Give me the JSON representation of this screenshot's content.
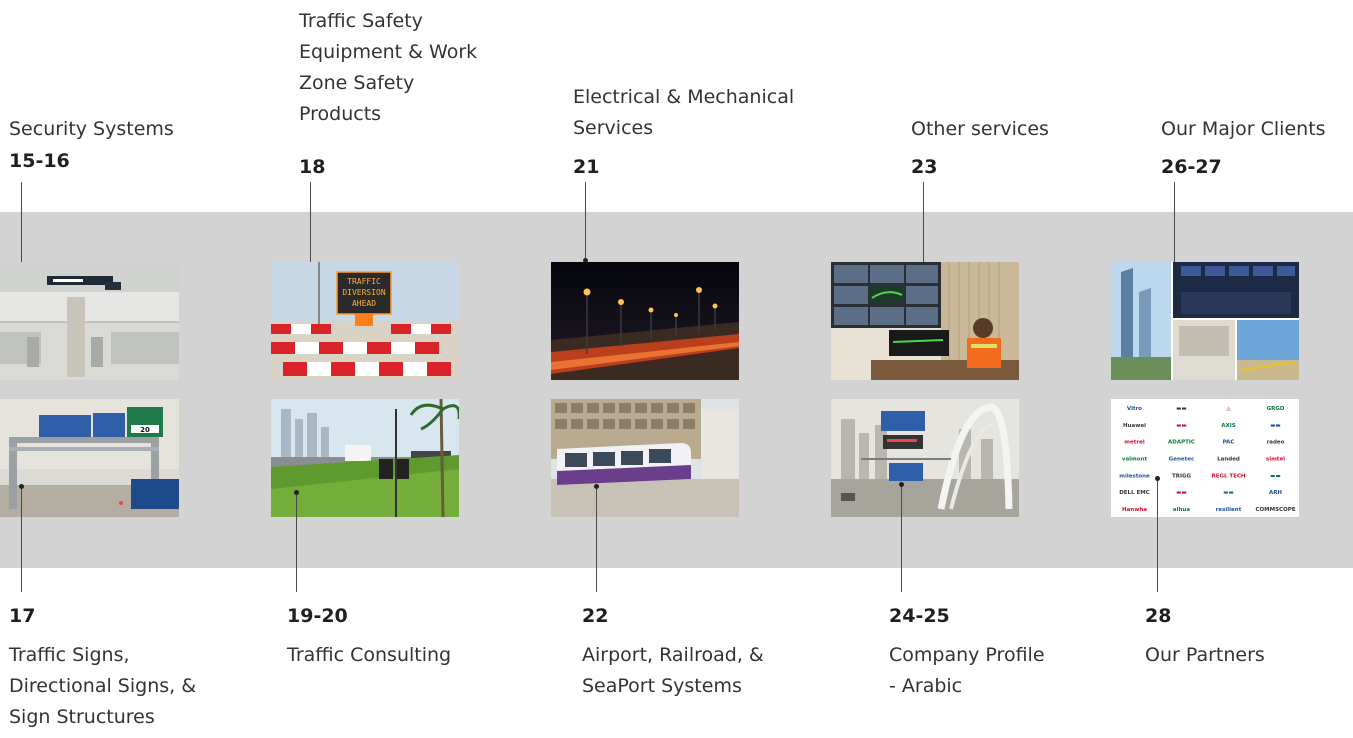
{
  "top_items": [
    {
      "id": "security",
      "lines": [
        "Security Systems"
      ],
      "pages": "15-16"
    },
    {
      "id": "traffic-safety",
      "lines": [
        "Traffic Safety",
        "Equipment & Work",
        "Zone Safety",
        "Products"
      ],
      "pages": "18"
    },
    {
      "id": "electrical",
      "lines": [
        "Electrical & Mechanical",
        "Services"
      ],
      "pages": "21"
    },
    {
      "id": "other",
      "lines": [
        "Other services"
      ],
      "pages": "23"
    },
    {
      "id": "clients",
      "lines": [
        "Our Major Clients"
      ],
      "pages": "26-27"
    }
  ],
  "bottom_items": [
    {
      "id": "signs",
      "lines": [
        "Traffic Signs,",
        "Directional Signs, &",
        "Sign Structures"
      ],
      "pages": "17"
    },
    {
      "id": "consulting",
      "lines": [
        "Traffic Consulting"
      ],
      "pages": "19-20"
    },
    {
      "id": "airport",
      "lines": [
        "Airport, Railroad, &",
        "SeaPort Systems"
      ],
      "pages": "22"
    },
    {
      "id": "profile",
      "lines": [
        "Company Profile",
        "- Arabic"
      ],
      "pages": "24-25"
    },
    {
      "id": "partners",
      "lines": [
        "Our Partners"
      ],
      "pages": "28"
    }
  ],
  "images": {
    "vms_sign_text": [
      "TRAFFIC",
      "DIVERSION",
      "AHEAD"
    ],
    "gantry_sign_number": "20",
    "partner_logos": [
      [
        "Vitro",
        "▬▬",
        "◬",
        "GRGD"
      ],
      [
        "Huawei",
        "▬▬",
        "AXIS",
        "▬▬"
      ],
      [
        "metrel",
        "ADAPTIC",
        "PAC",
        "radeo"
      ],
      [
        "valmont",
        "Genetec",
        "Landed",
        "simtel"
      ],
      [
        "milestone",
        "TRIGG",
        "REGL TECH",
        "▬▬"
      ],
      [
        "DELL EMC",
        "▬▬",
        "▬▬",
        "ARH"
      ],
      [
        "Hanwha",
        "alhua",
        "resilient",
        "COMMSCOPE"
      ]
    ]
  },
  "colors": {
    "band": "#d3d3d3",
    "text": "#333333",
    "number": "#1f1f1f",
    "line": "#4a4a4a"
  }
}
